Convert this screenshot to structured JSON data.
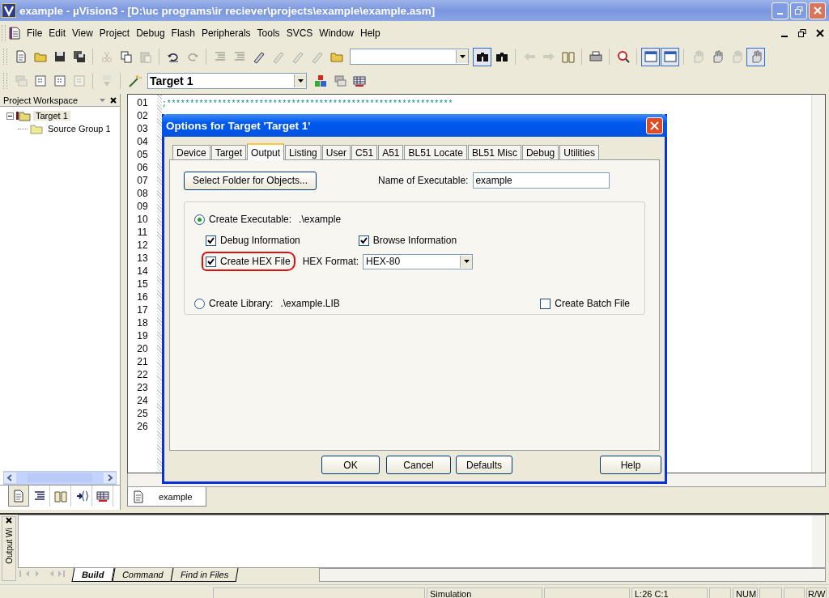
{
  "window": {
    "title": "example  - µVision3 - [D:\\uc programs\\ir reciever\\projects\\example\\example.asm]"
  },
  "menu": [
    "File",
    "Edit",
    "View",
    "Project",
    "Debug",
    "Flash",
    "Peripherals",
    "Tools",
    "SVCS",
    "Window",
    "Help"
  ],
  "toolbar_1": [
    {
      "kind": "button",
      "disabled": false,
      "pressed": false
    },
    {
      "kind": "button",
      "disabled": false,
      "pressed": false
    },
    {
      "kind": "button",
      "disabled": false,
      "pressed": false
    },
    {
      "kind": "button",
      "disabled": false,
      "pressed": false
    },
    {
      "kind": "separator"
    },
    {
      "kind": "button",
      "disabled": true,
      "pressed": false
    },
    {
      "kind": "button",
      "disabled": false,
      "pressed": false
    },
    {
      "kind": "button",
      "disabled": true,
      "pressed": false
    },
    {
      "kind": "separator"
    },
    {
      "kind": "button",
      "disabled": false,
      "pressed": false
    },
    {
      "kind": "button",
      "disabled": true,
      "pressed": false
    },
    {
      "kind": "separator"
    },
    {
      "kind": "button",
      "disabled": true,
      "pressed": false
    },
    {
      "kind": "button",
      "disabled": true,
      "pressed": false
    },
    {
      "kind": "button",
      "disabled": false,
      "pressed": false
    },
    {
      "kind": "button",
      "disabled": true,
      "pressed": false
    },
    {
      "kind": "button",
      "disabled": true,
      "pressed": false
    },
    {
      "kind": "button",
      "disabled": true,
      "pressed": false
    },
    {
      "kind": "button",
      "disabled": false,
      "pressed": false
    },
    {
      "kind": "combo"
    },
    {
      "kind": "button",
      "disabled": false,
      "pressed": true
    },
    {
      "kind": "button",
      "disabled": false,
      "pressed": false
    },
    {
      "kind": "separator"
    },
    {
      "kind": "button",
      "disabled": true,
      "pressed": false
    },
    {
      "kind": "button",
      "disabled": true,
      "pressed": false
    },
    {
      "kind": "button",
      "disabled": false,
      "pressed": false
    },
    {
      "kind": "separator"
    },
    {
      "kind": "button",
      "disabled": false,
      "pressed": false
    },
    {
      "kind": "separator"
    },
    {
      "kind": "button",
      "disabled": false,
      "pressed": false
    },
    {
      "kind": "separator"
    },
    {
      "kind": "button",
      "disabled": false,
      "pressed": true
    },
    {
      "kind": "button",
      "disabled": false,
      "pressed": true
    },
    {
      "kind": "separator"
    },
    {
      "kind": "button",
      "disabled": true,
      "pressed": false
    },
    {
      "kind": "button",
      "disabled": false,
      "pressed": false
    },
    {
      "kind": "button",
      "disabled": true,
      "pressed": false
    },
    {
      "kind": "button",
      "disabled": false,
      "pressed": true
    }
  ],
  "toolbar_2": [
    {
      "kind": "button",
      "disabled": true,
      "pressed": false
    },
    {
      "kind": "button",
      "disabled": false,
      "pressed": false
    },
    {
      "kind": "button",
      "disabled": false,
      "pressed": false
    },
    {
      "kind": "button",
      "disabled": true,
      "pressed": false
    },
    {
      "kind": "separator"
    },
    {
      "kind": "button",
      "disabled": true,
      "pressed": false
    },
    {
      "kind": "separator"
    },
    {
      "kind": "button",
      "disabled": false,
      "pressed": false
    },
    {
      "kind": "combo",
      "value": "Target 1"
    },
    {
      "kind": "button",
      "disabled": false,
      "pressed": false
    },
    {
      "kind": "button",
      "disabled": false,
      "pressed": false
    },
    {
      "kind": "button",
      "disabled": false,
      "pressed": false
    }
  ],
  "project_workspace": {
    "title": "Project Workspace",
    "tree": [
      {
        "label": "Target 1",
        "expanded": true,
        "selected": true,
        "children": [
          {
            "label": "Source Group 1"
          }
        ]
      }
    ],
    "tabs": [
      {
        "selected": true
      },
      {
        "selected": false
      },
      {
        "selected": false
      },
      {
        "selected": false
      },
      {
        "selected": false
      }
    ]
  },
  "editor": {
    "line_numbers": [
      "01",
      "02",
      "03",
      "04",
      "05",
      "06",
      "07",
      "08",
      "09",
      "10",
      "11",
      "12",
      "13",
      "14",
      "15",
      "16",
      "17",
      "18",
      "19",
      "20",
      "21",
      "22",
      "23",
      "24",
      "25",
      "26"
    ],
    "first_line": ";**************************************************************",
    "tabs": [
      {
        "label": "example",
        "selected": true
      }
    ]
  },
  "dialog": {
    "title": "Options for Target 'Target 1'",
    "tabs": [
      {
        "label": "Device",
        "selected": false
      },
      {
        "label": "Target",
        "selected": false
      },
      {
        "label": "Output",
        "selected": true
      },
      {
        "label": "Listing",
        "selected": false
      },
      {
        "label": "User",
        "selected": false
      },
      {
        "label": "C51",
        "selected": false
      },
      {
        "label": "A51",
        "selected": false
      },
      {
        "label": "BL51 Locate",
        "selected": false
      },
      {
        "label": "BL51 Misc",
        "selected": false
      },
      {
        "label": "Debug",
        "selected": false
      },
      {
        "label": "Utilities",
        "selected": false
      }
    ],
    "select_folder_button": "Select Folder for Objects...",
    "name_of_executable": {
      "label": "Name of Executable:",
      "value": "example"
    },
    "create_executable": {
      "label": "Create Executable:",
      "path": ".\\example",
      "selected": true
    },
    "options": [
      {
        "label": "Debug Information",
        "checked": true,
        "circled": false
      },
      {
        "label": "Browse Information",
        "checked": true,
        "circled": false
      },
      {
        "label": "Create HEX File",
        "checked": true,
        "circled": true
      }
    ],
    "hex_format": {
      "label": "HEX Format:",
      "value": "HEX-80"
    },
    "create_library": {
      "label": "Create Library:",
      "path": ".\\example.LIB",
      "selected": false
    },
    "create_batch_file": {
      "label": "Create Batch File",
      "checked": false
    },
    "buttons": [
      "OK",
      "Cancel",
      "Defaults",
      "Help"
    ]
  },
  "output_window": {
    "title": "Output Wi",
    "tabs": [
      {
        "label": "Build",
        "selected": true
      },
      {
        "label": "Command",
        "selected": false
      },
      {
        "label": "Find in Files",
        "selected": false
      }
    ]
  },
  "status_bar": [
    {
      "kind": "blank"
    },
    {
      "kind": "text",
      "text": "Simulation"
    },
    {
      "kind": "blank"
    },
    {
      "kind": "text",
      "text": "L:26 C:1"
    },
    {
      "kind": "blank"
    },
    {
      "kind": "text",
      "text": "NUM"
    },
    {
      "kind": "blank"
    },
    {
      "kind": "blank"
    },
    {
      "kind": "text",
      "text": "R/W"
    }
  ]
}
